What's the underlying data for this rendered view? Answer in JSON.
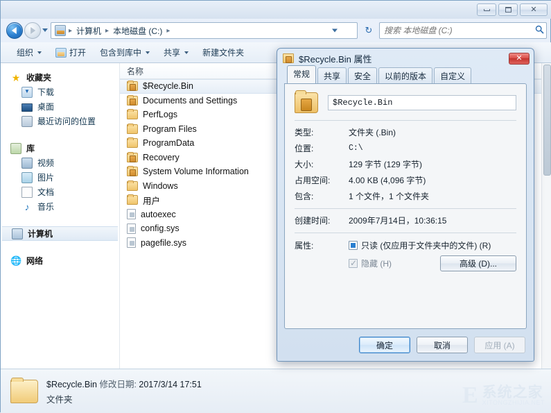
{
  "window": {
    "minimize_label": "",
    "maximize_label": "",
    "close_label": "✕"
  },
  "address": {
    "crumbs": [
      "计算机",
      "本地磁盘 (C:)"
    ],
    "separator": "▸",
    "refresh_icon": "↻"
  },
  "search": {
    "placeholder": "搜索 本地磁盘 (C:)",
    "value": "",
    "icon": "🔍"
  },
  "toolbar": {
    "items": [
      {
        "label": "组织",
        "caret": true,
        "icon": null
      },
      {
        "label": "打开",
        "caret": false,
        "icon": "open-folder-icon"
      },
      {
        "label": "包含到库中",
        "caret": true,
        "icon": null
      },
      {
        "label": "共享",
        "caret": true,
        "icon": null
      },
      {
        "label": "新建文件夹",
        "caret": false,
        "icon": null
      }
    ]
  },
  "sidebar": {
    "groups": [
      {
        "head": {
          "label": "收藏夹",
          "icon": "star-icon"
        },
        "items": [
          {
            "label": "下载",
            "icon": "download-icon"
          },
          {
            "label": "桌面",
            "icon": "desktop-icon"
          },
          {
            "label": "最近访问的位置",
            "icon": "recent-places-icon"
          }
        ]
      },
      {
        "head": {
          "label": "库",
          "icon": "library-icon"
        },
        "items": [
          {
            "label": "视频",
            "icon": "video-icon"
          },
          {
            "label": "图片",
            "icon": "pictures-icon"
          },
          {
            "label": "文档",
            "icon": "documents-icon"
          },
          {
            "label": "音乐",
            "icon": "music-icon"
          }
        ]
      },
      {
        "head": {
          "label": "计算机",
          "icon": "computer-icon",
          "selected": true
        },
        "items": []
      },
      {
        "head": {
          "label": "网络",
          "icon": "network-icon"
        },
        "items": []
      }
    ]
  },
  "filelist": {
    "column_header": "名称",
    "rows": [
      {
        "name": "$Recycle.Bin",
        "type": "folder-locked",
        "selected": true
      },
      {
        "name": "Documents and Settings",
        "type": "folder-locked",
        "selected": false
      },
      {
        "name": "PerfLogs",
        "type": "folder",
        "selected": false
      },
      {
        "name": "Program Files",
        "type": "folder",
        "selected": false
      },
      {
        "name": "ProgramData",
        "type": "folder",
        "selected": false
      },
      {
        "name": "Recovery",
        "type": "folder-locked",
        "selected": false
      },
      {
        "name": "System Volume Information",
        "type": "folder-locked",
        "selected": false
      },
      {
        "name": "Windows",
        "type": "folder",
        "selected": false
      },
      {
        "name": "用户",
        "type": "folder",
        "selected": false
      },
      {
        "name": "autoexec",
        "type": "file",
        "selected": false
      },
      {
        "name": "config.sys",
        "type": "file",
        "selected": false
      },
      {
        "name": "pagefile.sys",
        "type": "file",
        "selected": false
      }
    ]
  },
  "statusbar": {
    "name": "$Recycle.Bin",
    "modified_label": "修改日期:",
    "modified_value": "2017/3/14 17:51",
    "kind": "文件夹"
  },
  "watermark": {
    "mark": "E",
    "cn": "系统之家",
    "en": "XITONGZHIJIA.NET"
  },
  "dialog": {
    "title": "$Recycle.Bin 属性",
    "close_label": "✕",
    "tabs": [
      {
        "label": "常规",
        "active": true
      },
      {
        "label": "共享",
        "active": false
      },
      {
        "label": "安全",
        "active": false
      },
      {
        "label": "以前的版本",
        "active": false
      },
      {
        "label": "自定义",
        "active": false
      }
    ],
    "name_value": "$Recycle.Bin",
    "properties": [
      {
        "label": "类型:",
        "value": "文件夹 (.Bin)",
        "cjk": true
      },
      {
        "label": "位置:",
        "value": "C:\\",
        "cjk": false
      },
      {
        "label": "大小:",
        "value": "129 字节 (129 字节)",
        "cjk": true
      },
      {
        "label": "占用空间:",
        "value": "4.00 KB (4,096 字节)",
        "cjk": true
      },
      {
        "label": "包含:",
        "value": "1 个文件，1 个文件夹",
        "cjk": true
      }
    ],
    "created": {
      "label": "创建时间:",
      "value": "2009年7月14日，10:36:15"
    },
    "attributes": {
      "label": "属性:",
      "readonly_label": "只读 (仅应用于文件夹中的文件) (R)",
      "hidden_label": "隐藏 (H)",
      "advanced_label": "高级 (D)..."
    },
    "buttons": {
      "ok": "确定",
      "cancel": "取消",
      "apply": "应用 (A)"
    }
  }
}
